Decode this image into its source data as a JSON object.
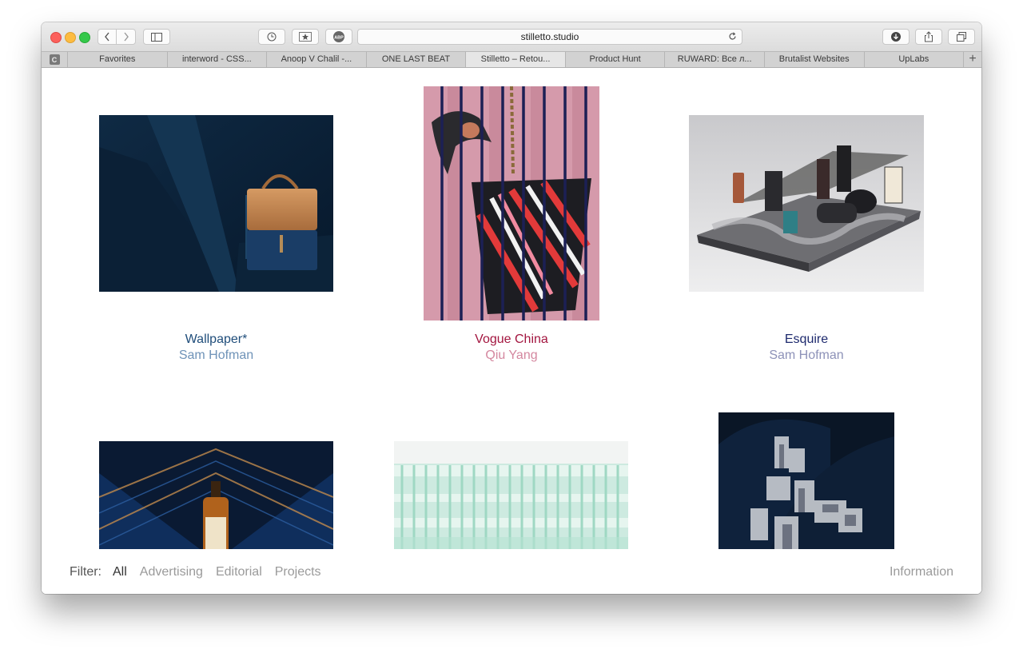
{
  "browser": {
    "url": "stilletto.studio",
    "tabs": [
      {
        "label": "Favorites",
        "active": false
      },
      {
        "label": "interword - CSS...",
        "active": false
      },
      {
        "label": "Anoop V Chalil -...",
        "active": false
      },
      {
        "label": "ONE LAST BEAT",
        "active": false
      },
      {
        "label": "Stilletto – Retou...",
        "active": true
      },
      {
        "label": "Product Hunt",
        "active": false
      },
      {
        "label": "RUWARD: Все л...",
        "active": false
      },
      {
        "label": "Brutalist Websites",
        "active": false
      },
      {
        "label": "UpLabs",
        "active": false
      }
    ],
    "pinned_tab_letter": "C",
    "abp_label": "ABP",
    "new_tab_glyph": "+"
  },
  "projects": [
    {
      "title": "Wallpaper*",
      "author": "Sam Hofman",
      "title_color": "#1f4d7a",
      "author_color": "#6f93b8"
    },
    {
      "title": "Vogue China",
      "author": "Qiu Yang",
      "title_color": "#a3153f",
      "author_color": "#d4879f"
    },
    {
      "title": "Esquire",
      "author": "Sam Hofman",
      "title_color": "#1e2a6e",
      "author_color": "#8d92b8"
    }
  ],
  "filter": {
    "label": "Filter:",
    "options": [
      "All",
      "Advertising",
      "Editorial",
      "Projects"
    ]
  },
  "information_link": "Information",
  "icons": [
    "back-icon",
    "forward-icon",
    "sidebar-icon",
    "history-icon",
    "bookmarks-icon",
    "adblock-icon",
    "reload-icon",
    "download-icon",
    "share-icon",
    "tabs-overview-icon"
  ]
}
